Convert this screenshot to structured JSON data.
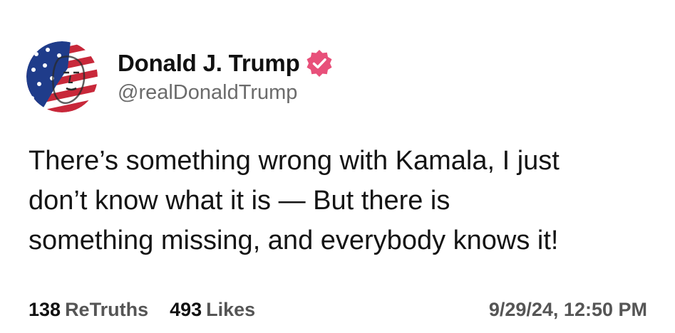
{
  "author": {
    "display_name": "Donald J. Trump",
    "handle": "@realDonaldTrump",
    "avatar_icon": "stars-and-stripes-portrait-avatar",
    "verified_icon": "verified-badge-icon"
  },
  "post": {
    "lines": [
      "There’s something wrong with Kamala, I just",
      "don’t know what it is — But there is",
      "something missing, and everybody knows it!"
    ]
  },
  "stats": {
    "retruths_count": "138",
    "retruths_label": "ReTruths",
    "likes_count": "493",
    "likes_label": "Likes",
    "timestamp": "9/29/24, 12:50 PM"
  },
  "colors": {
    "verified": "#e8507a",
    "flag_red": "#c8283a",
    "flag_blue": "#1f3c8a"
  }
}
